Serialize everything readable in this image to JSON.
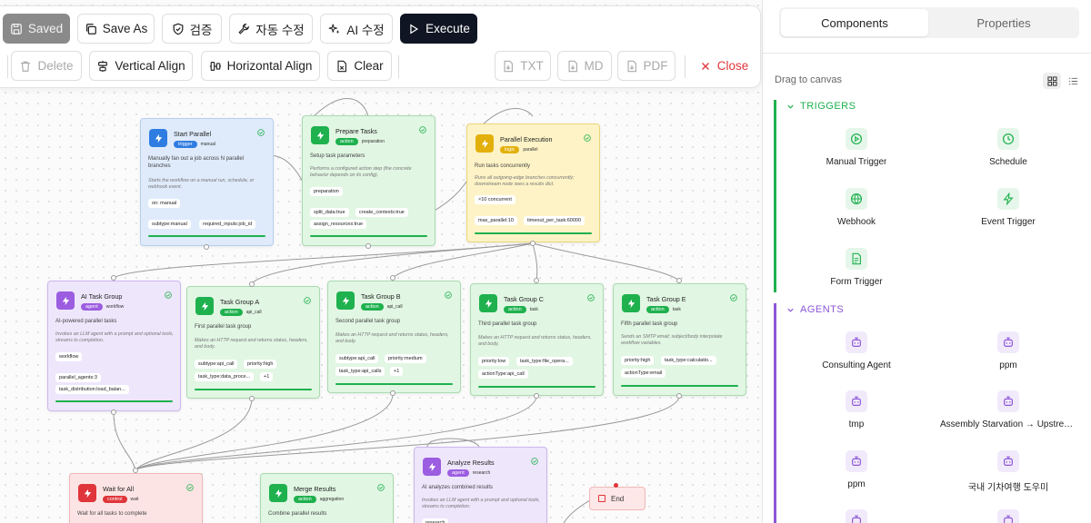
{
  "toolbar": {
    "saved": "Saved",
    "save_as": "Save As",
    "verify": "검증",
    "auto_fix": "자동 수정",
    "ai_fix": "AI 수정",
    "execute": "Execute",
    "delete": "Delete",
    "vertical_align": "Vertical Align",
    "horizontal_align": "Horizontal Align",
    "clear": "Clear",
    "txt": "TXT",
    "md": "MD",
    "pdf": "PDF",
    "close": "Close"
  },
  "nodes": {
    "start_parallel": {
      "title": "Start Parallel",
      "tag": "trigger",
      "sub": "manual",
      "desc": "Manually fan out a job across N parallel branches",
      "note": "Starts the workflow on a manual run, schedule, or webhook event.",
      "chips": [
        "on: manual",
        "subtype:manual",
        "required_inputs:job_id"
      ]
    },
    "prepare_tasks": {
      "title": "Prepare Tasks",
      "tag": "action",
      "sub": "preparation",
      "desc": "Setup task parameters",
      "note": "Performs a configured action step (the concrete behavior depends on its config).",
      "chips": [
        "preparation",
        "split_data:true",
        "create_contexts:true",
        "assign_resources:true"
      ]
    },
    "parallel_execution": {
      "title": "Parallel Execution",
      "tag": "logic",
      "sub": "parallel",
      "desc": "Run tasks concurrently",
      "note": "Runs all outgoing-edge branches concurrently; downstream node sees a results dict.",
      "chips": [
        "×10 concurrent",
        "max_parallel:10",
        "timeout_per_task:60000"
      ]
    },
    "ai_task_group": {
      "title": "AI Task Group",
      "tag": "agent",
      "sub": "workflow",
      "desc": "AI-powered parallel tasks",
      "note": "Invokes an LLM agent with a prompt and optional tools, streams to completion.",
      "chips": [
        "workflow",
        "parallel_agents:3",
        "task_distribution:load_balan..."
      ]
    },
    "task_group_a": {
      "title": "Task Group A",
      "tag": "action",
      "sub": "api_call",
      "desc": "First parallel task group",
      "note": "Makes an HTTP request and returns status, headers, and body.",
      "chips": [
        "subtype:api_call",
        "priority:high",
        "task_type:data_proce...",
        "+1"
      ]
    },
    "task_group_b": {
      "title": "Task Group B",
      "tag": "action",
      "sub": "api_call",
      "desc": "Second parallel task group",
      "note": "Makes an HTTP request and returns status, headers, and body.",
      "chips": [
        "subtype:api_call",
        "priority:medium",
        "task_type:api_calls",
        "+1"
      ]
    },
    "task_group_c": {
      "title": "Task Group C",
      "tag": "action",
      "sub": "task",
      "desc": "Third parallel task group",
      "note": "Makes an HTTP request and returns status, headers, and body.",
      "chips": [
        "priority:low",
        "task_type:file_opera...",
        "actionType:api_call"
      ]
    },
    "task_group_e": {
      "title": "Task Group E",
      "tag": "action",
      "sub": "task",
      "desc": "Fifth parallel task group",
      "note": "Sends an SMTP email; subject/body interpolate workflow variables.",
      "chips": [
        "priority:high",
        "task_type:calculatio...",
        "actionType:email"
      ]
    },
    "wait_for_all": {
      "title": "Wait for All",
      "tag": "control",
      "sub": "wait",
      "desc": "Wait for all tasks to complete"
    },
    "merge_results": {
      "title": "Merge Results",
      "tag": "action",
      "sub": "aggregation",
      "desc": "Combine parallel results"
    },
    "analyze_results": {
      "title": "Analyze Results",
      "tag": "agent",
      "sub": "research",
      "desc": "AI analyzes combined results",
      "note": "Invokes an LLM agent with a prompt and optional tools, streams to completion.",
      "chips": [
        "research"
      ]
    },
    "end": {
      "title": "End"
    }
  },
  "panel": {
    "tab_components": "Components",
    "tab_properties": "Properties",
    "drag_hint": "Drag to canvas",
    "triggers_title": "TRIGGERS",
    "triggers": [
      "Manual Trigger",
      "Schedule",
      "Webhook",
      "Event Trigger",
      "Form Trigger"
    ],
    "agents_title": "AGENTS",
    "agents": [
      "Consulting Agent",
      "ppm",
      "tmp",
      "Assembly Starvation → Upstream Blockage",
      "ppm",
      "국내 기차여행 도우미"
    ]
  },
  "colors": {
    "trigger": "#2f7de1",
    "action": "#1fb14e",
    "logic": "#e3b00b",
    "agent": "#9c5de0",
    "control": "#e0353a",
    "triggers_accent": "#1fb14e",
    "agents_accent": "#8c56d8"
  }
}
